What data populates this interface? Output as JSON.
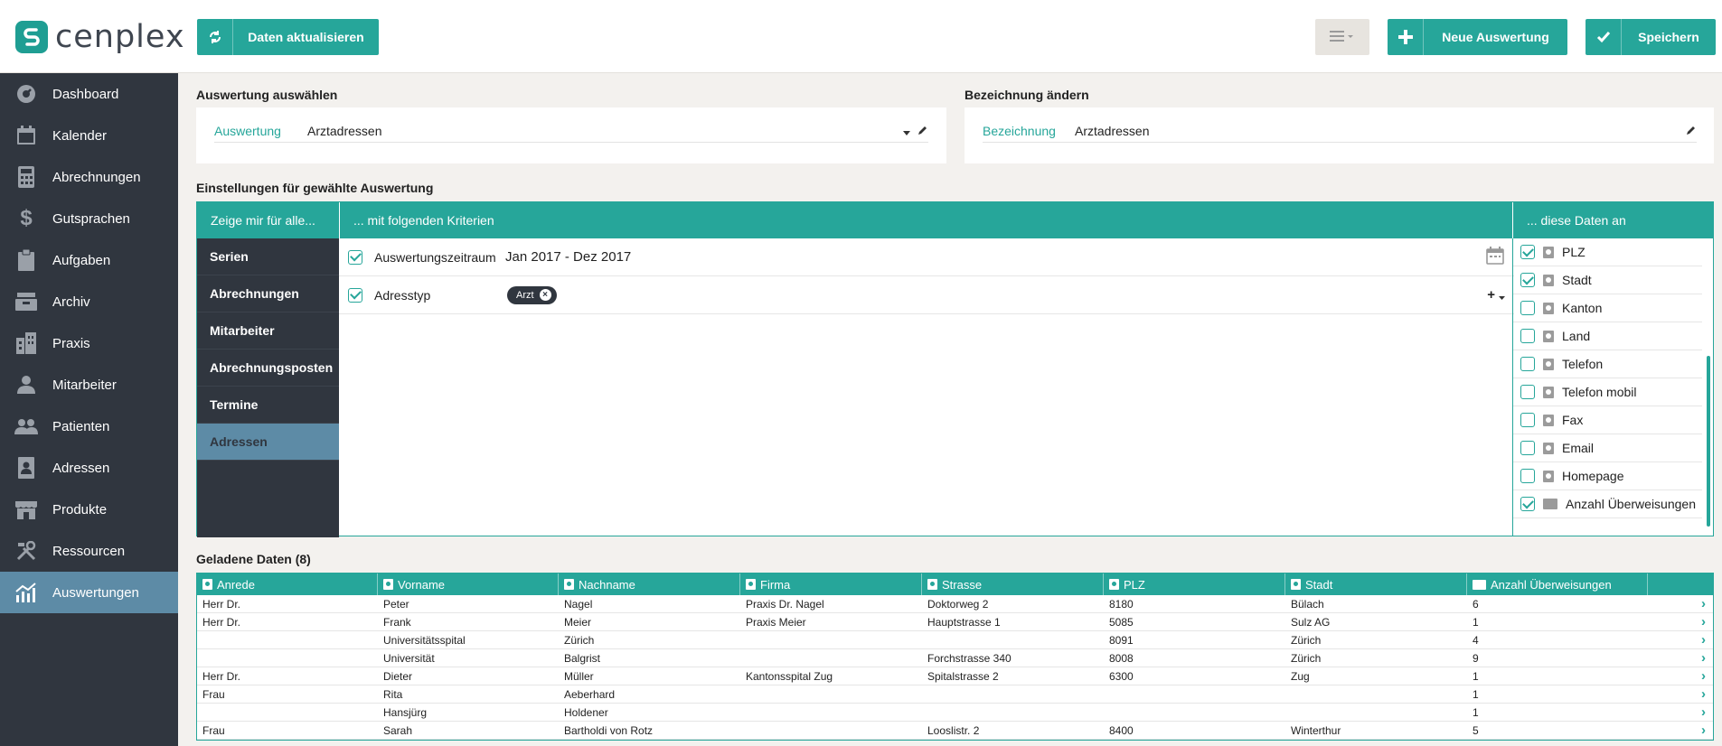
{
  "app": {
    "logo_text": "cenplex",
    "accent": "#26a69a",
    "sidebar_bg": "#30363f",
    "active_bg": "#5d8ba6"
  },
  "toolbar": {
    "refresh_label": "Daten aktualisieren",
    "new_label": "Neue Auswertung",
    "save_label": "Speichern"
  },
  "sidebar": {
    "items": [
      {
        "label": "Dashboard",
        "icon": "dashboard-icon"
      },
      {
        "label": "Kalender",
        "icon": "calendar-icon"
      },
      {
        "label": "Abrechnungen",
        "icon": "calculator-icon"
      },
      {
        "label": "Gutsprachen",
        "icon": "dollar-icon"
      },
      {
        "label": "Aufgaben",
        "icon": "clipboard-icon"
      },
      {
        "label": "Archiv",
        "icon": "archive-icon"
      },
      {
        "label": "Praxis",
        "icon": "building-icon"
      },
      {
        "label": "Mitarbeiter",
        "icon": "staff-icon"
      },
      {
        "label": "Patienten",
        "icon": "patients-icon"
      },
      {
        "label": "Adressen",
        "icon": "address-book-icon"
      },
      {
        "label": "Produkte",
        "icon": "shop-icon"
      },
      {
        "label": "Ressourcen",
        "icon": "tools-icon"
      },
      {
        "label": "Auswertungen",
        "icon": "chart-icon",
        "active": true
      }
    ]
  },
  "select": {
    "title": "Auswertung auswählen",
    "label": "Auswertung",
    "value": "Arztadressen"
  },
  "rename": {
    "title": "Bezeichnung ändern",
    "label": "Bezeichnung",
    "value": "Arztadressen"
  },
  "settings": {
    "title": "Einstellungen für gewählte Auswertung",
    "col1_header": "Zeige mir für alle...",
    "col2_header": "... mit folgenden Kriterien",
    "col3_header": "... diese Daten an",
    "categories": [
      "Serien",
      "Abrechnungen",
      "Mitarbeiter",
      "Abrechnungsposten",
      "Termine",
      "Adressen"
    ],
    "active_category": "Adressen",
    "criteria": [
      {
        "label": "Auswertungszeitraum",
        "value": "Jan 2017 - Dez 2017",
        "checked": true
      },
      {
        "label": "Adresstyp",
        "chip": "Arzt",
        "checked": true
      }
    ],
    "fields": [
      {
        "label": "PLZ",
        "checked": true,
        "icon": "person-icon"
      },
      {
        "label": "Stadt",
        "checked": true,
        "icon": "person-icon"
      },
      {
        "label": "Kanton",
        "checked": false,
        "icon": "person-icon"
      },
      {
        "label": "Land",
        "checked": false,
        "icon": "person-icon"
      },
      {
        "label": "Telefon",
        "checked": false,
        "icon": "person-icon"
      },
      {
        "label": "Telefon mobil",
        "checked": false,
        "icon": "person-icon"
      },
      {
        "label": "Fax",
        "checked": false,
        "icon": "person-icon"
      },
      {
        "label": "Email",
        "checked": false,
        "icon": "person-icon"
      },
      {
        "label": "Homepage",
        "checked": false,
        "icon": "person-icon"
      },
      {
        "label": "Anzahl Überweisungen",
        "checked": true,
        "icon": "folder-icon"
      }
    ]
  },
  "table": {
    "title": "Geladene Daten (8)",
    "columns": [
      "Anrede",
      "Vorname",
      "Nachname",
      "Firma",
      "Strasse",
      "PLZ",
      "Stadt",
      "Anzahl Überweisungen"
    ],
    "rows": [
      [
        "Herr Dr.",
        "Peter",
        "Nagel",
        "Praxis Dr. Nagel",
        "Doktorweg 2",
        "8180",
        "Bülach",
        "6"
      ],
      [
        "Herr Dr.",
        "Frank",
        "Meier",
        "Praxis Meier",
        "Hauptstrasse 1",
        "5085",
        "Sulz AG",
        "1"
      ],
      [
        "",
        "Universitätsspital",
        "Zürich",
        "",
        "",
        "8091",
        "Zürich",
        "4"
      ],
      [
        "",
        "Universität",
        "Balgrist",
        "",
        "Forchstrasse 340",
        "8008",
        "Zürich",
        "9"
      ],
      [
        "Herr Dr.",
        "Dieter",
        "Müller",
        "Kantonsspital Zug",
        "Spitalstrasse 2",
        "6300",
        "Zug",
        "1"
      ],
      [
        "Frau",
        "Rita",
        "Aeberhard",
        "",
        "",
        "",
        "",
        "1"
      ],
      [
        "",
        "Hansjürg",
        "Holdener",
        "",
        "",
        "",
        "",
        "1"
      ],
      [
        "Frau",
        "Sarah",
        "Bartholdi von Rotz",
        "",
        "Looslistr. 2",
        "8400",
        "Winterthur",
        "5"
      ]
    ]
  }
}
